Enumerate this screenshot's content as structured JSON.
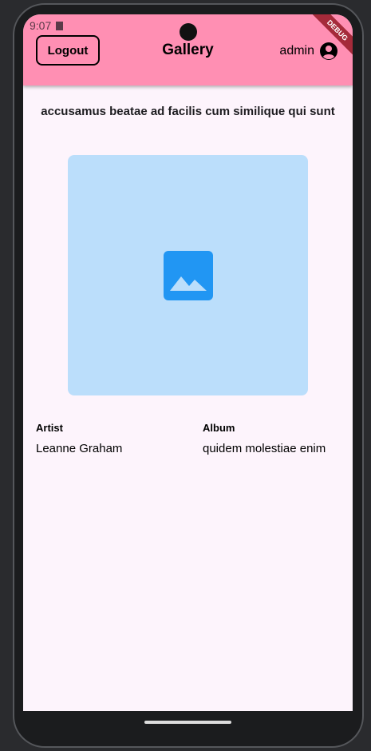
{
  "status": {
    "time": "9:07"
  },
  "appbar": {
    "logout_label": "Logout",
    "title": "Gallery",
    "username": "admin",
    "debug_label": "DEBUG"
  },
  "photo": {
    "title": "accusamus beatae ad facilis cum similique qui sunt",
    "image_icon": "image-icon"
  },
  "details": {
    "artist_label": "Artist",
    "artist_value": "Leanne Graham",
    "album_label": "Album",
    "album_value": "quidem molestiae enim"
  },
  "colors": {
    "appbar": "#ff8fb3",
    "placeholder": "#bbdefb",
    "icon": "#2196f3"
  }
}
